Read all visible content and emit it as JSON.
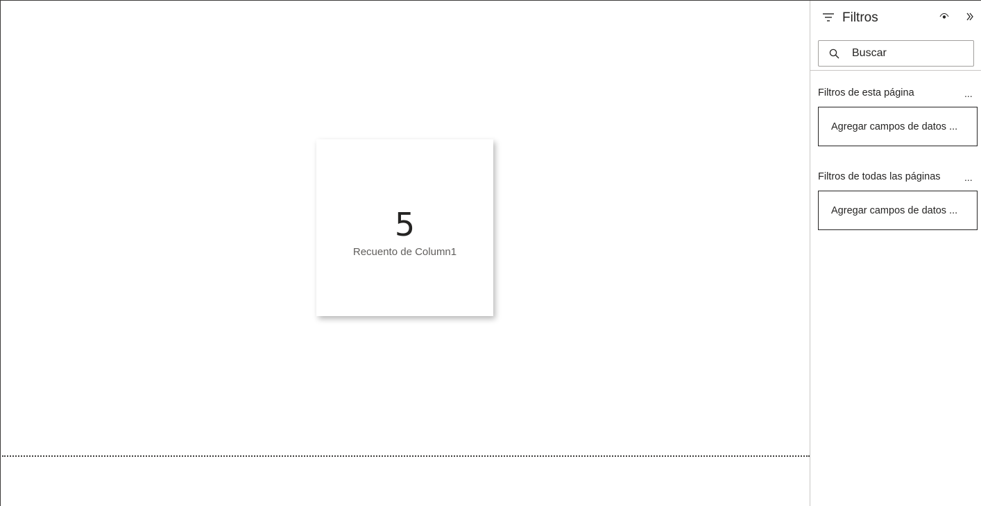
{
  "card": {
    "value": "5",
    "label": "Recuento de Column1"
  },
  "filter_pane": {
    "title": "Filtros",
    "icons": {
      "header": "filter-icon",
      "visibility": "eye-icon",
      "collapse": "double-chevron-right-icon",
      "search": "search-icon",
      "more": "more-options-icon"
    },
    "search": {
      "placeholder": "Buscar"
    },
    "sections": [
      {
        "title": "Filtros de esta página",
        "more_label": "...",
        "drop_well_text": "Agregar campos de datos ..."
      },
      {
        "title": "Filtros de todas las páginas",
        "more_label": "...",
        "drop_well_text": "Agregar campos de datos ..."
      }
    ]
  },
  "colors": {
    "text_primary": "#252423",
    "text_secondary": "#605e5c",
    "border": "#c8c6c4"
  }
}
